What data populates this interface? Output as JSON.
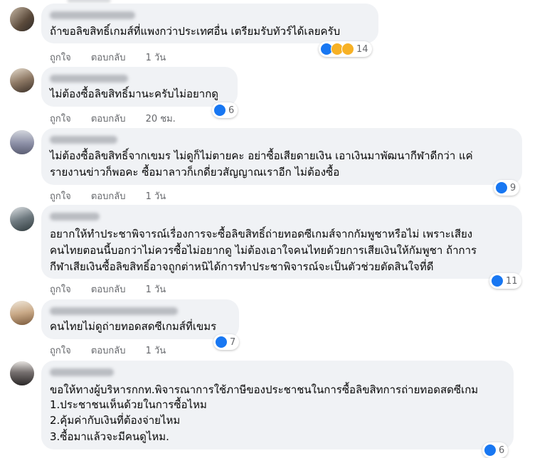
{
  "comments": [
    {
      "text": [
        "ถ้าขอลิขสิทธิ์เกมส์ที่แพงกว่าประเทศอื่น เตรียมรับทัวร์ได้เลยครับ"
      ],
      "like_label": "ถูกใจ",
      "reply_label": "ตอบกลับ",
      "time": "1 วัน",
      "reactions": [
        "like-icon",
        "haha-icon",
        "wow-icon"
      ],
      "reaction_count": "14"
    },
    {
      "text": [
        "ไม่ต้องซื้อลิขสิทธิ์มานะครับไม่อยากดู"
      ],
      "like_label": "ถูกใจ",
      "reply_label": "ตอบกลับ",
      "time": "20 ชม.",
      "reactions": [
        "like-icon"
      ],
      "reaction_count": "6"
    },
    {
      "text": [
        "ไม่ต้องซื้อลิขสิทธิ์จากเขมร ไม่ดูก็ไม่ตายคะ อย่าซื้อเสียดายเงิน เอาเงินมาพัฒนากีฬาดีกว่า แค่",
        "รายงานข่าวก็พอคะ ซื้อมาลาวก็เกดี่ยวสัญญาณเราอีก ไม่ต้องซื้อ"
      ],
      "like_label": "ถูกใจ",
      "reply_label": "ตอบกลับ",
      "time": "1 วัน",
      "reactions": [
        "like-icon"
      ],
      "reaction_count": "9"
    },
    {
      "text": [
        "อยากให้ทำประชาพิจารณ์เรื่องการจะซื้อลิขสิทธิ์ถ่ายทอดซีเกมส์จากกัมพูชาหรือไม่ เพราะเสียง",
        "คนไทยตอนนี้บอกว่าไม่ควรซื้อไม่อยากดู ไม่ต้องเอาใจคนไทยด้วยการเสียเงินให้กัมพูชา ถ้าการ",
        "กีฬาเสียเงินซื้อลิขสิทธิ์อาจถูกต่าหนิได้การทำประชาพิจารณ์จะเป็นตัวช่วยตัดสินใจที่ดี"
      ],
      "like_label": "ถูกใจ",
      "reply_label": "ตอบกลับ",
      "time": "1 วัน",
      "reactions": [
        "like-icon"
      ],
      "reaction_count": "11"
    },
    {
      "text": [
        "คนไทยไม่ดูถ่ายทอดสดซีเกมส์ที่เขมร"
      ],
      "like_label": "ถูกใจ",
      "reply_label": "ตอบกลับ",
      "time": "1 วัน",
      "reactions": [
        "like-icon"
      ],
      "reaction_count": "7"
    },
    {
      "text": [
        "ขอให้ทางผู้บริหารกกท.พิจารณาการใช้ภาษีของประชาชนในการซื้อลิขสิทการถ่ายทอดสดซีเกม",
        "1.ประชาชนเห็นด้วยในการซื้อไหม",
        "2.คุ้มค่ากับเงินที่ต้องจ่ายไหม",
        "3.ซื้อมาแล้วจะมีคนดูไหม."
      ],
      "reactions": [
        "like-icon"
      ],
      "reaction_count": "6"
    }
  ],
  "colors": {
    "like": "#1877f2",
    "haha": "#f7b125",
    "bubble": "#f0f2f5",
    "meta": "#65676b"
  }
}
